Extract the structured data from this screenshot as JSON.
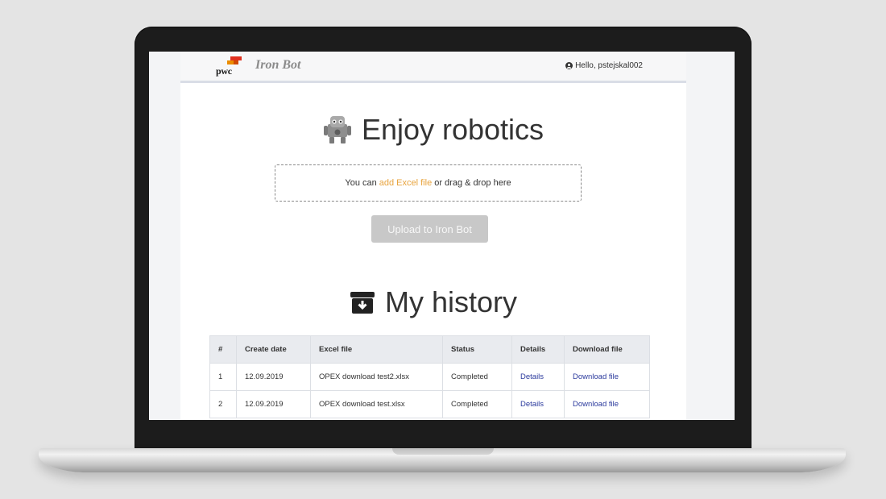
{
  "header": {
    "logo_text": "pwc",
    "brand": "Iron Bot",
    "greeting": "Hello, pstejskal002"
  },
  "hero": {
    "title": "Enjoy robotics",
    "icon": "robot-icon"
  },
  "dropzone": {
    "prefix": "You can",
    "link": "add Excel file",
    "suffix": "or drag & drop here"
  },
  "upload_button": "Upload to Iron Bot",
  "history": {
    "title": "My history",
    "icon": "archive-download-icon",
    "columns": [
      "#",
      "Create date",
      "Excel file",
      "Status",
      "Details",
      "Download file"
    ],
    "rows": [
      {
        "num": "1",
        "date": "12.09.2019",
        "file": "OPEX download test2.xlsx",
        "status": "Completed",
        "details": "Details",
        "download": "Download file"
      },
      {
        "num": "2",
        "date": "12.09.2019",
        "file": "OPEX download test.xlsx",
        "status": "Completed",
        "details": "Details",
        "download": "Download file"
      }
    ]
  },
  "colors": {
    "link_orange": "#e8a33c",
    "link_blue": "#2b3a9d",
    "button_disabled": "#c8c8c8"
  }
}
